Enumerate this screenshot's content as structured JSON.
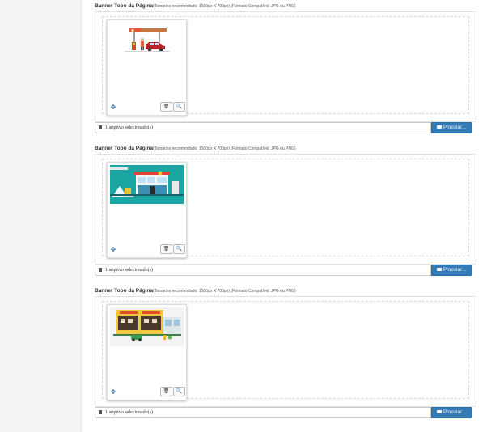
{
  "sections": [
    {
      "label": "Banner Topo da Página",
      "hint": "(Tamanho recomendado: 1920px X 700px) (Formato Compatível: JPG ou PNG)",
      "file_status": "1  arquivo  selecionado(s)",
      "browse_label": "Procurar…",
      "image": "gas-station-illustration"
    },
    {
      "label": "Banner Topo da Página",
      "hint": "(Tamanho recomendado: 1920px X 700px) (Formato Compatível: JPG ou PNG)",
      "file_status": "1  arquivo  selecionado(s)",
      "browse_label": "Procurar…",
      "image": "convenience-store-teal-illustration"
    },
    {
      "label": "Banner Topo da Página",
      "hint": "(Tamanho recomendado: 1920px X 700px) (Formato Compatível: JPG ou PNG)",
      "file_status": "1  arquivo  selecionado(s)",
      "browse_label": "Procurar…",
      "image": "storefront-illustration"
    }
  ],
  "icons": {
    "move": "arrows-move-icon",
    "delete": "trash-icon",
    "zoom": "zoom-in-icon",
    "file": "file-icon",
    "browse": "folder-open-icon"
  },
  "colors": {
    "primary": "#337ab7",
    "move_icon": "#2f6fb0",
    "teal_banner": "#1aa6a3"
  }
}
